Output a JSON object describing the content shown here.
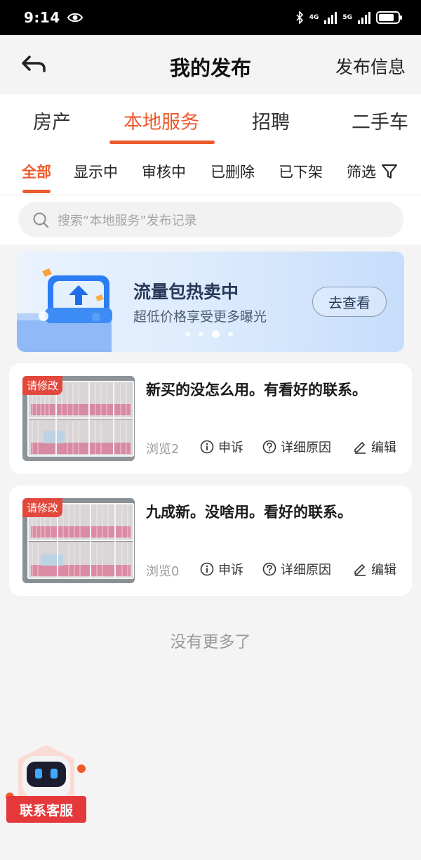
{
  "status_bar": {
    "time": "9:14",
    "net1": "4G",
    "net2": "5G"
  },
  "nav": {
    "title": "我的发布",
    "action": "发布信息"
  },
  "category_tabs": [
    {
      "label": "房产"
    },
    {
      "label": "本地服务",
      "active": true
    },
    {
      "label": "招聘"
    },
    {
      "label": "二手车"
    }
  ],
  "status_tabs": [
    {
      "label": "全部",
      "active": true
    },
    {
      "label": "显示中"
    },
    {
      "label": "审核中"
    },
    {
      "label": "已删除"
    },
    {
      "label": "已下架"
    },
    {
      "label": "筛选"
    }
  ],
  "search": {
    "placeholder": "搜索“本地服务”发布记录"
  },
  "banner": {
    "title": "流量包热卖中",
    "subtitle": "超低价格享受更多曝光",
    "button": "去查看",
    "active_dot": 3,
    "dot_count": 4
  },
  "listings": [
    {
      "badge": "请修改",
      "title": "新买的没怎么用。有看好的联系。",
      "views": "浏览2",
      "appeal": "申诉",
      "details": "详细原因",
      "edit": "编辑"
    },
    {
      "badge": "请修改",
      "title": "九成新。没啥用。看好的联系。",
      "views": "浏览0",
      "appeal": "申诉",
      "details": "详细原因",
      "edit": "编辑"
    }
  ],
  "footer": {
    "no_more": "没有更多了"
  },
  "customer_service": {
    "label": "联系客服"
  },
  "colors": {
    "accent": "#ee5a2c",
    "badge": "#e2483c",
    "cs": "#e5383b"
  }
}
